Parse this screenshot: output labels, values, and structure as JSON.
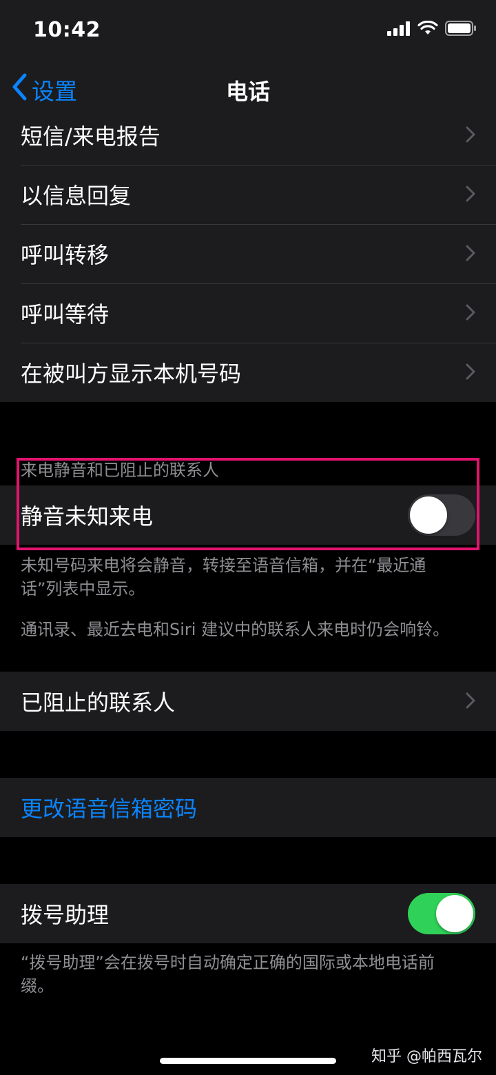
{
  "status_bar": {
    "time": "10:42"
  },
  "nav": {
    "back_label": "设置",
    "title": "电话"
  },
  "section1": {
    "rows": [
      {
        "label": "短信/来电报告"
      },
      {
        "label": "以信息回复"
      },
      {
        "label": "呼叫转移"
      },
      {
        "label": "呼叫等待"
      },
      {
        "label": "在被叫方显示本机号码"
      }
    ]
  },
  "section2": {
    "header": "来电静音和已阻止的联系人",
    "silence_row": {
      "label": "静音未知来电",
      "toggle_on": false
    },
    "footer_line1": "未知号码来电将会静音，转接至语音信箱，并在“最近通话”列表中显示。",
    "footer_line2": "通讯录、最近去电和Siri 建议中的联系人来电时仍会响铃。"
  },
  "section3": {
    "row": {
      "label": "已阻止的联系人"
    }
  },
  "section4": {
    "row": {
      "label": "更改语音信箱密码"
    }
  },
  "section5": {
    "row": {
      "label": "拨号助理",
      "toggle_on": true
    },
    "footer": "“拨号助理”会在拨号时自动确定正确的国际或本地电话前缀。"
  },
  "watermark": "知乎 @帕西瓦尔",
  "colors": {
    "accent": "#0a84ff",
    "toggle_on": "#30d158",
    "highlight": "#e0146e"
  },
  "icons": [
    "cellular-signal-icon",
    "wifi-icon",
    "battery-icon",
    "back-chevron-icon",
    "chevron-right-icon"
  ]
}
